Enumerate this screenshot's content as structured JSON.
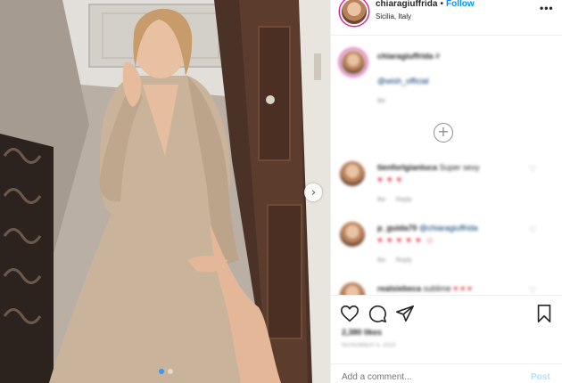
{
  "post": {
    "username": "chiaragiuffrida",
    "dot": "•",
    "follow_label": "Follow",
    "location": "Sicilia, Italy",
    "more_label": "•••"
  },
  "caption": {
    "username": "chiaragiuffrida",
    "text": "#",
    "mention": "@wish_official",
    "time": "8w"
  },
  "load_more_label": "+",
  "comments": [
    {
      "username": "tienforlgianluca",
      "text": "Super sexy",
      "emoji": "♥ ♥ ♥",
      "time": "8w",
      "reply": "Reply",
      "like": "♡"
    },
    {
      "username": "p_guida70",
      "mention": "@chiaragiuffrida",
      "text": "",
      "emoji": "♥ ♥ ♥ ♥ ♥ ☺",
      "time": "8w",
      "reply": "Reply",
      "like": "♡"
    },
    {
      "username": "realsiebeca",
      "text": "sublime",
      "emoji": "♥ ♥ ♥",
      "time": "",
      "reply": "",
      "like": "♡"
    }
  ],
  "actions": {
    "like_icon": "heart-outline-icon",
    "comment_icon": "comment-bubble-icon",
    "share_icon": "paper-plane-icon",
    "save_icon": "bookmark-icon"
  },
  "likes_label": "2,380 likes",
  "date_label": "NOVEMBER 5, 2020",
  "add_comment": {
    "placeholder": "Add a comment...",
    "post_label": "Post"
  },
  "colors": {
    "link_blue": "#0095f6",
    "post_disabled": "#b2dffc",
    "heart_red": "#ed4956",
    "story_ring": "#d6249f"
  }
}
